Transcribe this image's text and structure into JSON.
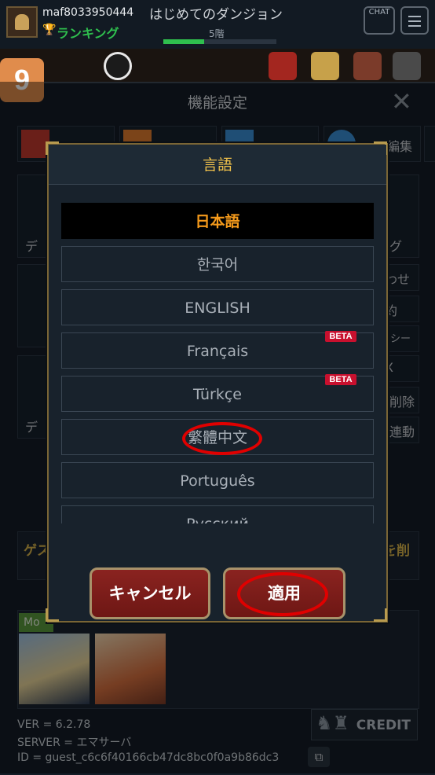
{
  "step_badge": "9",
  "player": {
    "username": "maf8033950444",
    "ranking_label": "ランキング"
  },
  "dungeon": {
    "title": "はじめてのダンジョン",
    "floor": "5階",
    "floor_progress": 0.36
  },
  "chat_label": "CHAT",
  "settings": {
    "title": "機能設定",
    "bg_labels": {
      "edit": "編集",
      "de1": "デ",
      "gu": "グ",
      "awase": "わせ",
      "yaku": "約",
      "policy": "リシー",
      "x": "X",
      "delete": "削除",
      "de2": "デ",
      "link": "連動"
    },
    "game_notice_left": "ゲス",
    "game_notice_right": "を削",
    "more_label": "Mo",
    "credit_label": "CREDIT",
    "version": "VER = 6.2.78",
    "server": "SERVER = エマサーバ",
    "id": "ID = guest_c6c6f40166cb47dc8bc0f0a9b86dc3"
  },
  "language_dialog": {
    "title": "言語",
    "options": [
      {
        "label": "日本語",
        "selected": true
      },
      {
        "label": "한국어"
      },
      {
        "label": "ENGLISH"
      },
      {
        "label": "Français",
        "badge": "BETA"
      },
      {
        "label": "Türkçe",
        "badge": "BETA"
      },
      {
        "label": "繁體中文"
      },
      {
        "label": "Português"
      },
      {
        "label": "Русский"
      }
    ],
    "cancel_label": "キャンセル",
    "apply_label": "適用"
  },
  "colors": {
    "accent_gold": "#f0c14b",
    "selected_text": "#f59a1b",
    "button_red": "#8a2320",
    "highlight_ring": "#e00000"
  }
}
